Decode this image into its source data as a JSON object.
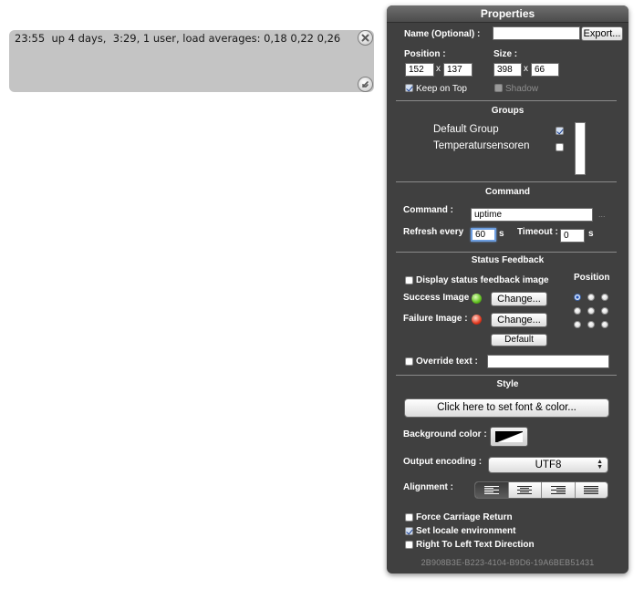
{
  "geeklet": {
    "output_text": "23:55  up 4 days,  3:29, 1 user, load averages: 0,18 0,22 0,26"
  },
  "panel": {
    "title": "Properties",
    "name_label": "Name (Optional) :",
    "name_value": "",
    "export_button": "Export...",
    "position_label": "Position :",
    "position_x": "152",
    "position_y": "137",
    "size_label": "Size :",
    "size_w": "398",
    "size_h": "66",
    "x_separator": "x",
    "keep_on_top_label": "Keep on Top",
    "keep_on_top_checked": true,
    "shadow_label": "Shadow",
    "shadow_checked": false
  },
  "groups": {
    "title": "Groups",
    "items": [
      {
        "label": "Default Group",
        "checked": true
      },
      {
        "label": "Temperatursensoren",
        "checked": false
      }
    ]
  },
  "command": {
    "title": "Command",
    "command_label": "Command :",
    "command_value": "uptime",
    "ellipsis": "...",
    "refresh_label": "Refresh every",
    "refresh_value": "60",
    "refresh_unit": "s",
    "timeout_label": "Timeout :",
    "timeout_value": "0",
    "timeout_unit": "s"
  },
  "status_feedback": {
    "title": "Status Feedback",
    "display_image_label": "Display status feedback image",
    "display_image_checked": false,
    "position_label": "Position",
    "position_selected": "top-left",
    "success_label": "Success Image :",
    "failure_label": "Failure Image :",
    "change_button": "Change...",
    "default_button": "Default",
    "override_label": "Override text :",
    "override_value": "",
    "success_color": "#5fbf1e",
    "failure_color": "#e2371d"
  },
  "style": {
    "title": "Style",
    "font_button": "Click here to set font & color...",
    "bg_color_label": "Background color :",
    "output_encoding_label": "Output encoding :",
    "output_encoding_value": "UTF8",
    "alignment_label": "Alignment :",
    "alignment_options": [
      "left",
      "center",
      "right",
      "justify"
    ],
    "alignment_selected": "left",
    "force_cr_label": "Force Carriage Return",
    "force_cr_checked": false,
    "set_locale_label": "Set locale environment",
    "set_locale_checked": true,
    "rtl_label": "Right To Left Text Direction",
    "rtl_checked": false
  },
  "footer": {
    "uuid": "2B908B3E-B223-4104-B9D6-19A6BEB51431"
  }
}
